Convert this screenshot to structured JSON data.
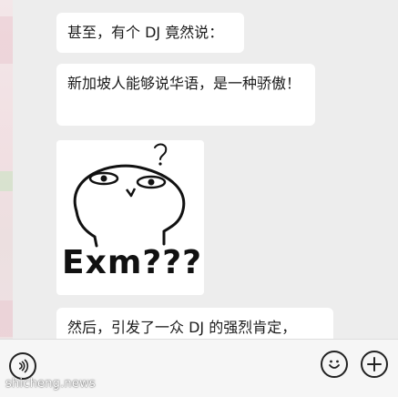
{
  "chat": {
    "messages": [
      {
        "text": "甚至，有个 DJ 竟然说："
      },
      {
        "text": "新加坡人能够说华语，是一种骄傲！"
      },
      {
        "sticker_caption": "Exm???"
      },
      {
        "text": "然后，引发了一众 DJ 的强烈肯定，"
      }
    ]
  },
  "input_bar": {
    "voice_icon": "voice-icon",
    "emoji_icon": "emoji-icon",
    "add_icon": "plus-icon"
  },
  "watermark": "shicheng.news",
  "colors": {
    "background": "#ededed",
    "bubble": "#ffffff",
    "text": "#1a1a1a"
  }
}
